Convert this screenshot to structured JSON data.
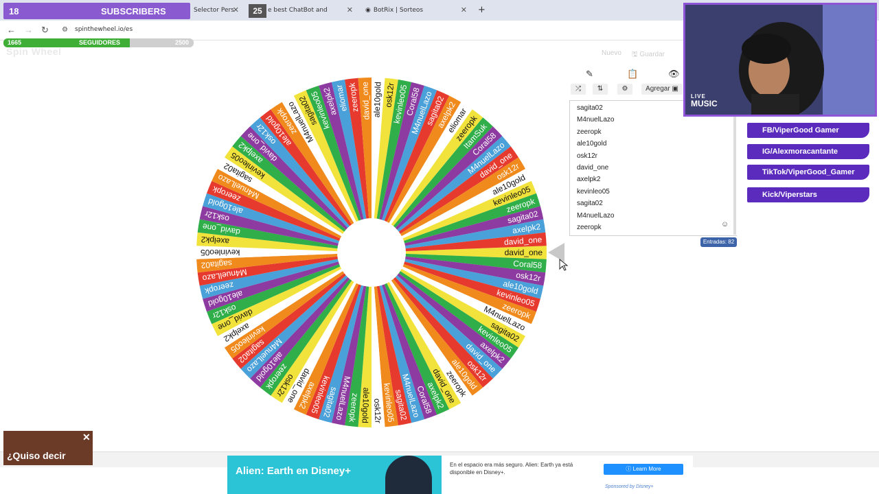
{
  "browser": {
    "tabs": [
      {
        "label": "Selector Pers"
      },
      {
        "label": "e best ChatBot and Widgets"
      },
      {
        "label": "BotRix | Sorteos"
      }
    ],
    "new_tab": "+",
    "url": "spinthewheel.io/es"
  },
  "overlay": {
    "subscriber_count": "18",
    "subscribers_label": "SUBSCRIBERS",
    "subscriber_goal": "25",
    "followers_current": "1665",
    "followers_label": "SEGUIDORES",
    "followers_goal": "2500",
    "followers_progress": 0.666,
    "brand": "Spin Wheel"
  },
  "top_actions": {
    "new": "Nuevo",
    "save": "Guardar"
  },
  "panel": {
    "add_label": "Agregar",
    "entries": [
      "sagita02",
      "M4nuelLazo",
      "zeeropk",
      "ale10gold",
      "osk12r",
      "david_one",
      "axelpk2",
      "kevinleo05",
      "sagita02",
      "M4nuelLazo",
      "zeeropk"
    ],
    "count_label": "Entradas: 82"
  },
  "wheel": {
    "names": [
      "david_one",
      "Coral58",
      "osk12r",
      "ale10gold",
      "kevinleo05",
      "zeeropk",
      "M4nuelLazo",
      "sagita02",
      "kevinleo05",
      "axelpk2",
      "david_one",
      "osk12r",
      "ale10gold",
      "zeeropk",
      "david_one",
      "axelpk2",
      "Coral58",
      "M4nuelLazo",
      "sagita02",
      "kevinleo05",
      "osk12r",
      "ale10gold",
      "zeeropk",
      "M4nuelLazo",
      "sagita02",
      "kevinleo05",
      "axelpk2",
      "david_one",
      "osk12r",
      "zeeropk",
      "ale10gold",
      "M4nuelLazo",
      "sagita02",
      "kevinleo05",
      "axelpk2",
      "david_one",
      "osk12r",
      "ale10gold",
      "zeeropk",
      "M4nuelLazo",
      "sagita02",
      "kevinleo05",
      "axelpk2",
      "david_one",
      "osk12r",
      "ale10gold",
      "zeeropk",
      "M4nuelLazo",
      "sagita02",
      "kevinleo05",
      "axelpk2",
      "david_one",
      "osk12r",
      "ale10gold",
      "zeeropk",
      "M4nuelLazo",
      "sagita02",
      "kevinleo05",
      "axelpk2",
      "eliomar",
      "zeeropk",
      "david_one",
      "ale10gold",
      "osk12r",
      "kevinleo05",
      "Coral58",
      "M4nuelLazo",
      "sagita02",
      "axelpk2",
      "eliomar",
      "zeeropk",
      "ItamSuk",
      "Coral58",
      "M4nuelLazo",
      "david_one",
      "osk12r",
      "ale10gold",
      "kevinleo05",
      "zeeropk",
      "sagita02",
      "axelpk2",
      "david_one"
    ],
    "colors": [
      "#f2e33c",
      "#2fae4a",
      "#8d3ba0",
      "#4aa0d8",
      "#e63a2e",
      "#f08a1c",
      "#ffffff"
    ]
  },
  "webcam": {
    "badge_top": "LIVE",
    "badge_bottom": "MUSIC"
  },
  "socials": [
    {
      "label": "FB/ViperGood Gamer"
    },
    {
      "label": "IG/Alexmoracantante"
    },
    {
      "label": "TikTok/ViperGood_Gamer"
    },
    {
      "label": "Kick/Viperstars"
    }
  ],
  "popup": {
    "text": "¿Quiso decir",
    "close": "✕"
  },
  "ad": {
    "title": "Alien: Earth en Disney+",
    "description": "En el espacio era más seguro. Alien: Earth ya está disponible en Disney+.",
    "cta": "Learn More",
    "sponsor": "Sponsored by Disney+"
  }
}
